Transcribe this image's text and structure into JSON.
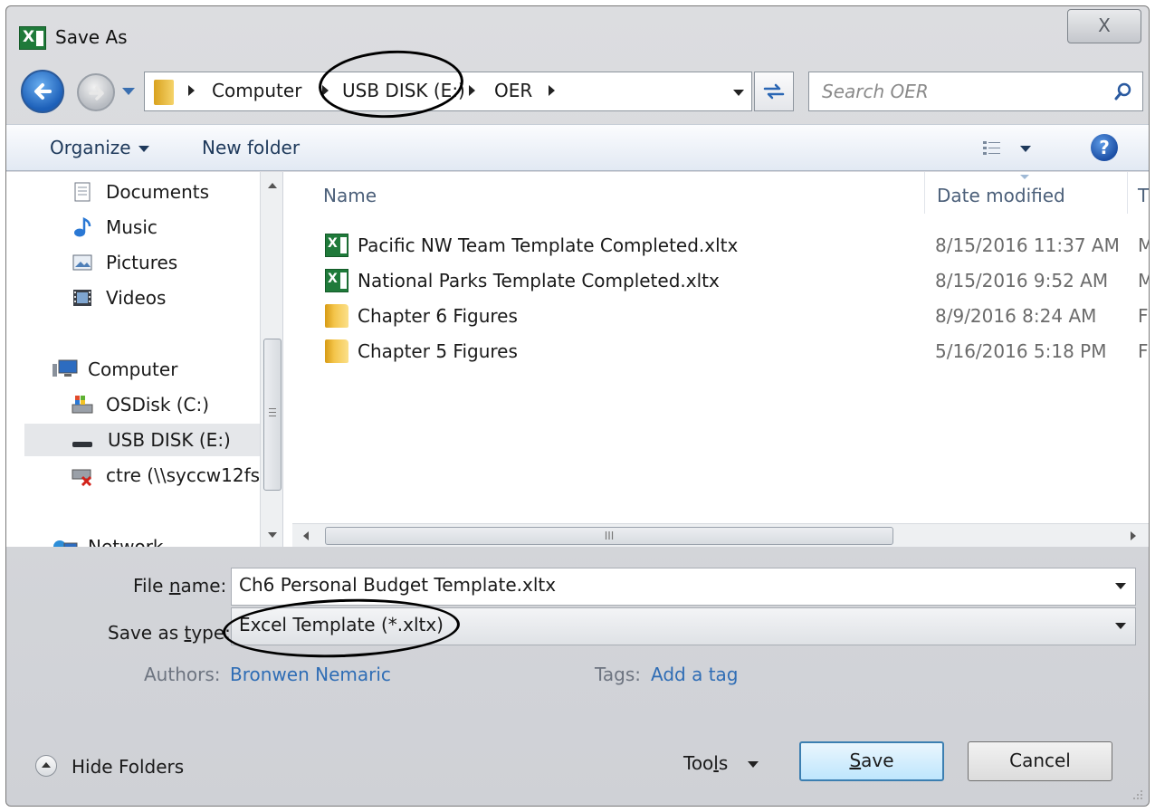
{
  "window": {
    "title": "Save As",
    "close_label": "X"
  },
  "nav": {
    "breadcrumbs": [
      "Computer",
      "USB DISK (E:)",
      "OER"
    ],
    "search_placeholder": "Search OER"
  },
  "toolbar": {
    "organize_label": "Organize",
    "new_folder_label": "New folder",
    "help_label": "?"
  },
  "sidebar": {
    "items": [
      {
        "label": "Documents",
        "icon": "documents-icon"
      },
      {
        "label": "Music",
        "icon": "music-icon"
      },
      {
        "label": "Pictures",
        "icon": "pictures-icon"
      },
      {
        "label": "Videos",
        "icon": "videos-icon"
      },
      {
        "label": "Computer",
        "icon": "computer-icon"
      },
      {
        "label": "OSDisk (C:)",
        "icon": "osdisk-icon"
      },
      {
        "label": "USB DISK (E:)",
        "icon": "usb-drive-icon",
        "selected": true
      },
      {
        "label": "ctre (\\\\syccw12fs",
        "icon": "network-drive-disconnected-icon"
      },
      {
        "label": "Network",
        "icon": "network-icon"
      }
    ]
  },
  "file_list": {
    "columns": [
      "Name",
      "Date modified",
      "T"
    ],
    "rows": [
      {
        "name": "Pacific NW Team Template Completed.xltx",
        "date": "8/15/2016 11:37 AM",
        "type": "M",
        "icon": "excel-template-icon"
      },
      {
        "name": "National Parks Template Completed.xltx",
        "date": "8/15/2016 9:52 AM",
        "type": "M",
        "icon": "excel-template-icon"
      },
      {
        "name": "Chapter 6 Figures",
        "date": "8/9/2016 8:24 AM",
        "type": "F",
        "icon": "folder-icon"
      },
      {
        "name": "Chapter 5 Figures",
        "date": "5/16/2016 5:18 PM",
        "type": "F",
        "icon": "folder-icon"
      }
    ],
    "hscroll_grip": "III"
  },
  "form": {
    "file_name_label_pre": "File ",
    "file_name_label_u": "n",
    "file_name_label_post": "ame:",
    "file_name_value": "Ch6 Personal Budget Template.xltx",
    "save_type_label_pre": "Save as ",
    "save_type_label_u": "t",
    "save_type_label_post": "ype:",
    "save_type_value": "Excel Template (*.xltx)",
    "authors_label": "Authors:",
    "authors_value": "Bronwen Nemaric",
    "tags_label": "Tags:",
    "tags_value": "Add a tag"
  },
  "footer": {
    "hide_folders_label": "Hide Folders",
    "tools_pre": "Too",
    "tools_u": "l",
    "tools_post": "s",
    "save_u": "S",
    "save_post": "ave",
    "cancel_label": "Cancel"
  },
  "colors": {
    "toolbar_text": "#1e395b",
    "link": "#2f6db5",
    "primary_button_border": "#3c7fb1"
  }
}
